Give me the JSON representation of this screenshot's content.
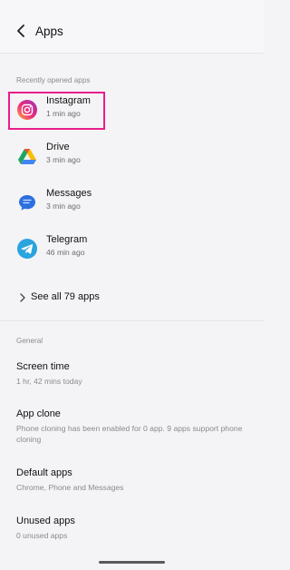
{
  "header": {
    "title": "Apps"
  },
  "recent": {
    "section_label": "Recently opened apps",
    "apps": [
      {
        "name": "Instagram",
        "time": "1 min ago",
        "icon": "instagram-icon"
      },
      {
        "name": "Drive",
        "time": "3 min ago",
        "icon": "drive-icon"
      },
      {
        "name": "Messages",
        "time": "3 min ago",
        "icon": "messages-icon"
      },
      {
        "name": "Telegram",
        "time": "46 min ago",
        "icon": "telegram-icon"
      }
    ],
    "see_all": "See all 79 apps"
  },
  "general": {
    "section_label": "General",
    "items": [
      {
        "name": "Screen time",
        "subtitle": "1 hr, 42 mins today"
      },
      {
        "name": "App clone",
        "subtitle": "Phone cloning has been enabled for 0 app. 9 apps support phone cloning"
      },
      {
        "name": "Default apps",
        "subtitle": "Chrome, Phone and Messages"
      },
      {
        "name": "Unused apps",
        "subtitle": "0 unused apps"
      }
    ]
  },
  "colors": {
    "highlight": "#e91e8c",
    "telegram": "#2aa3df",
    "messages": "#2d6fe0"
  }
}
